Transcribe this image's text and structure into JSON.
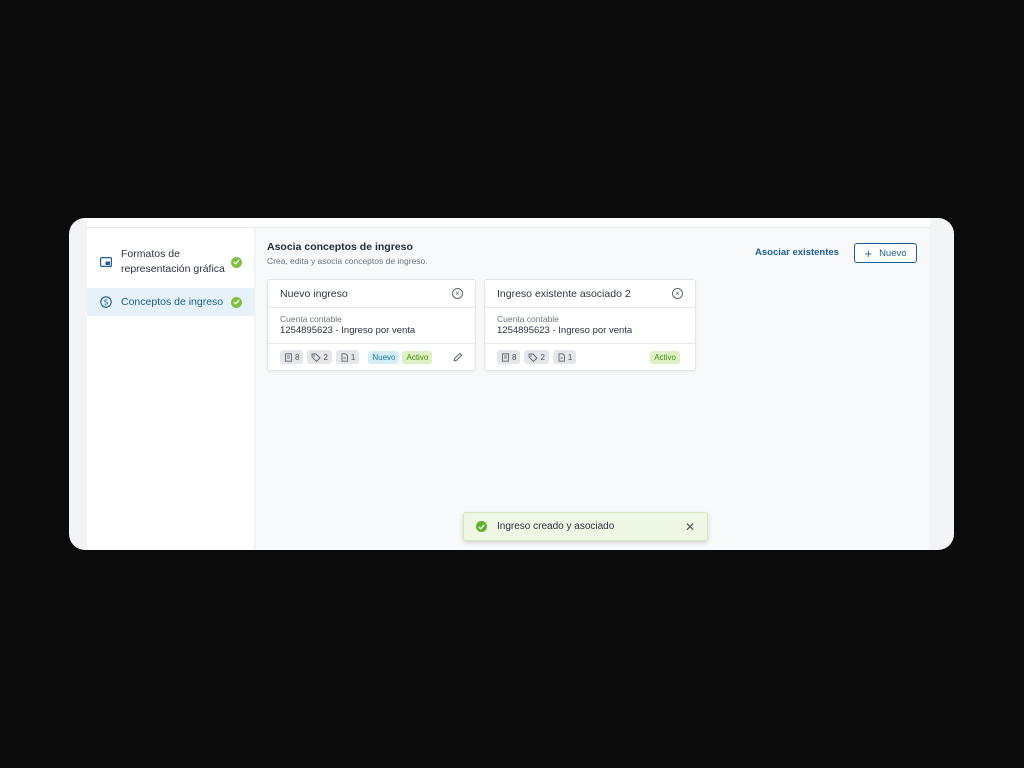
{
  "sidebar": {
    "items": [
      {
        "label_line1": "Formatos de",
        "label_line2": "representación gráfica",
        "icon": "picture-in-picture-icon",
        "completed": true
      },
      {
        "label": "Conceptos de ingreso",
        "icon": "dollar-circle-icon",
        "completed": true,
        "active": true
      }
    ]
  },
  "header": {
    "title": "Asocia conceptos de ingreso",
    "subtitle": "Crea, edita y asocia conceptos de ingreso.",
    "associate_label": "Asociar existentes",
    "new_label": "Nuevo"
  },
  "cards": [
    {
      "title": "Nuevo ingreso",
      "account_label": "Cuenta contable",
      "account_value": "1254895623 - Ingreso por venta",
      "counts": {
        "receipts": "8",
        "tags": "2",
        "documents": "1"
      },
      "badges": {
        "new": "Nuevo",
        "status": "Activo"
      },
      "editable": true
    },
    {
      "title": "Ingreso existente asociado 2",
      "account_label": "Cuenta contable",
      "account_value": "1254895623 - Ingreso por venta",
      "counts": {
        "receipts": "8",
        "tags": "2",
        "documents": "1"
      },
      "badges": {
        "status": "Activo"
      },
      "editable": false
    }
  ],
  "toast": {
    "message": "Ingreso creado y asociado",
    "type": "success"
  },
  "colors": {
    "accent": "#1e5f95",
    "success": "#7ec03f",
    "active_bg": "#e6f1f9",
    "badge_new_bg": "#d2eef8",
    "badge_active_bg": "#ddf2c4"
  }
}
